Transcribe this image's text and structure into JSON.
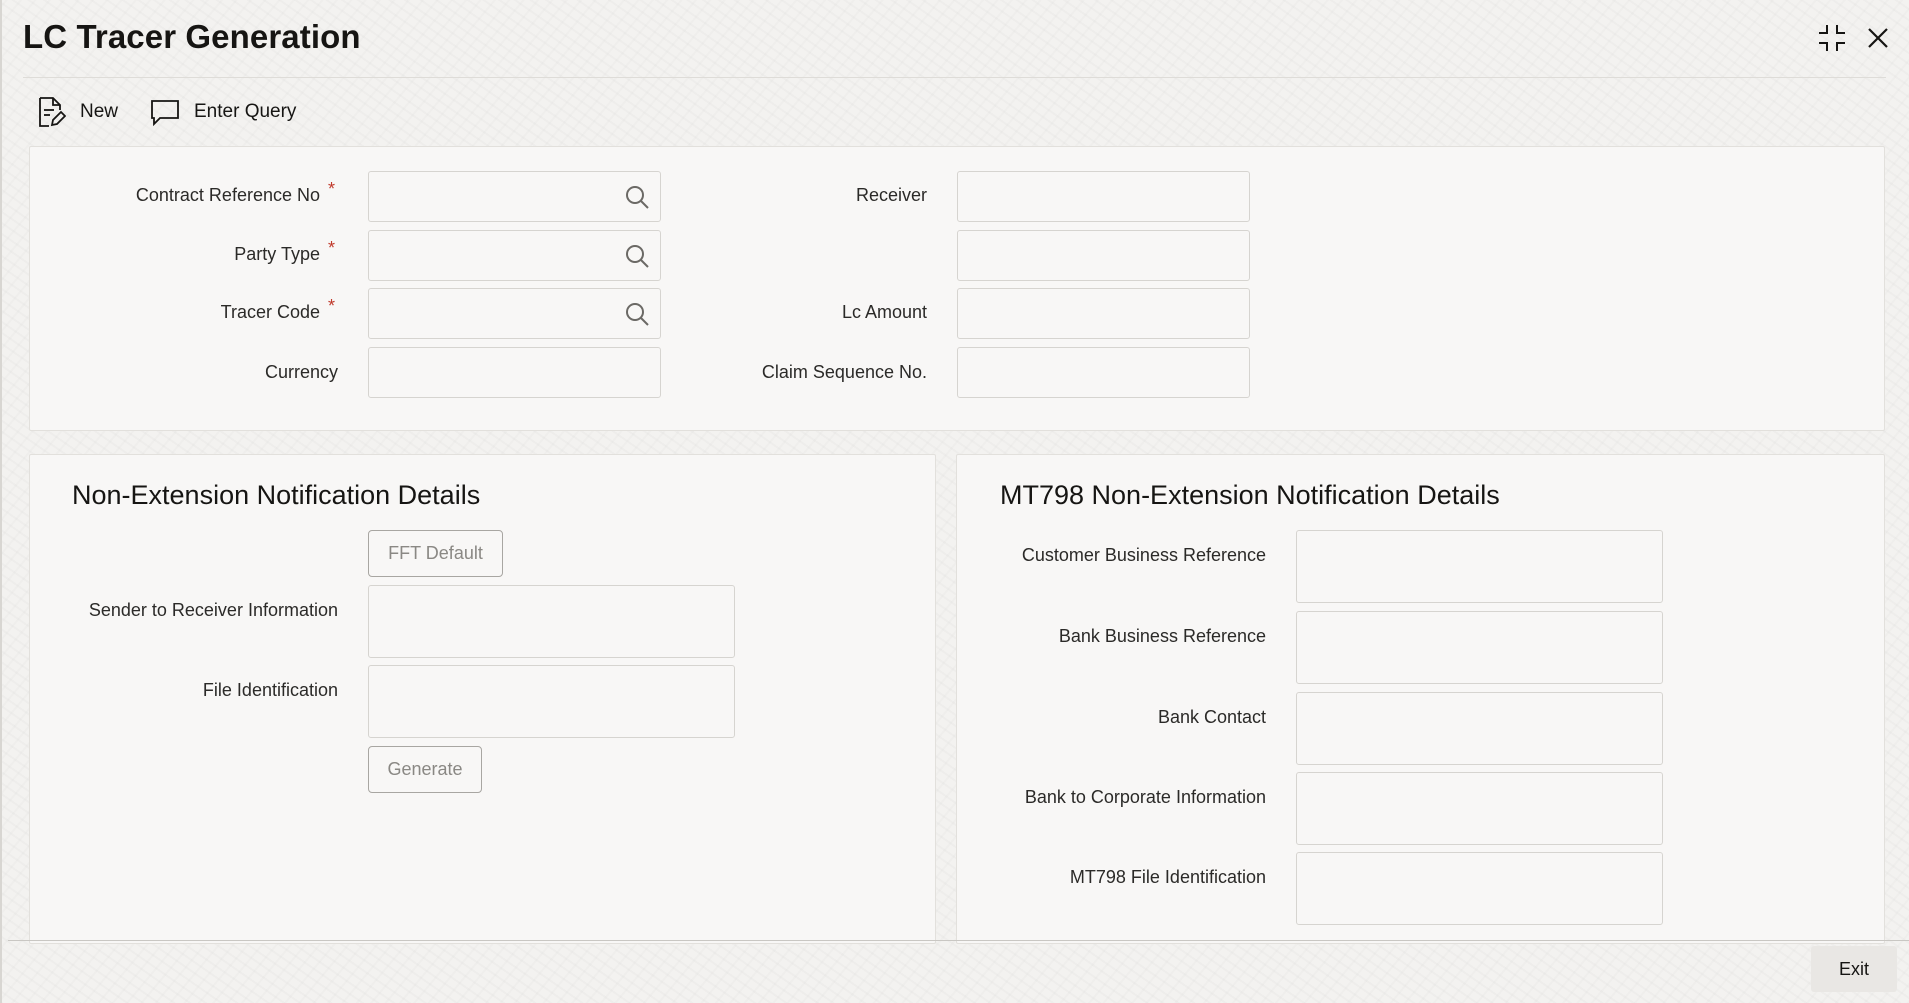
{
  "window": {
    "title": "LC Tracer Generation"
  },
  "toolbar": {
    "new_label": "New",
    "enter_query_label": "Enter Query"
  },
  "main": {
    "contract_reference_label": "Contract Reference No",
    "contract_reference_value": "",
    "party_type_label": "Party Type",
    "party_type_value": "",
    "tracer_code_label": "Tracer Code",
    "tracer_code_value": "",
    "currency_label": "Currency",
    "currency_value": "",
    "receiver_label": "Receiver",
    "receiver_value": "",
    "receiver_name_value": "",
    "lc_amount_label": "Lc Amount",
    "lc_amount_value": "",
    "claim_sequence_label": "Claim Sequence No.",
    "claim_sequence_value": "",
    "required_mark": "*"
  },
  "non_extension": {
    "title": "Non-Extension Notification Details",
    "fft_default_label": "FFT Default",
    "sender_to_receiver_label": "Sender to Receiver Information",
    "sender_to_receiver_value": "",
    "file_identification_label": "File Identification",
    "file_identification_value": "",
    "generate_label": "Generate"
  },
  "mt798": {
    "title": "MT798 Non-Extension Notification Details",
    "customer_business_reference_label": "Customer Business Reference",
    "customer_business_reference_value": "",
    "bank_business_reference_label": "Bank Business Reference",
    "bank_business_reference_value": "",
    "bank_contact_label": "Bank Contact",
    "bank_contact_value": "",
    "bank_to_corporate_label": "Bank to Corporate Information",
    "bank_to_corporate_value": "",
    "mt798_file_identification_label": "MT798 File Identification",
    "mt798_file_identification_value": ""
  },
  "footer": {
    "exit_label": "Exit"
  },
  "colors": {
    "required": "#c0392b",
    "text": "#161513",
    "panel_bg": "#f8f7f6",
    "border": "#d6d4d0"
  }
}
